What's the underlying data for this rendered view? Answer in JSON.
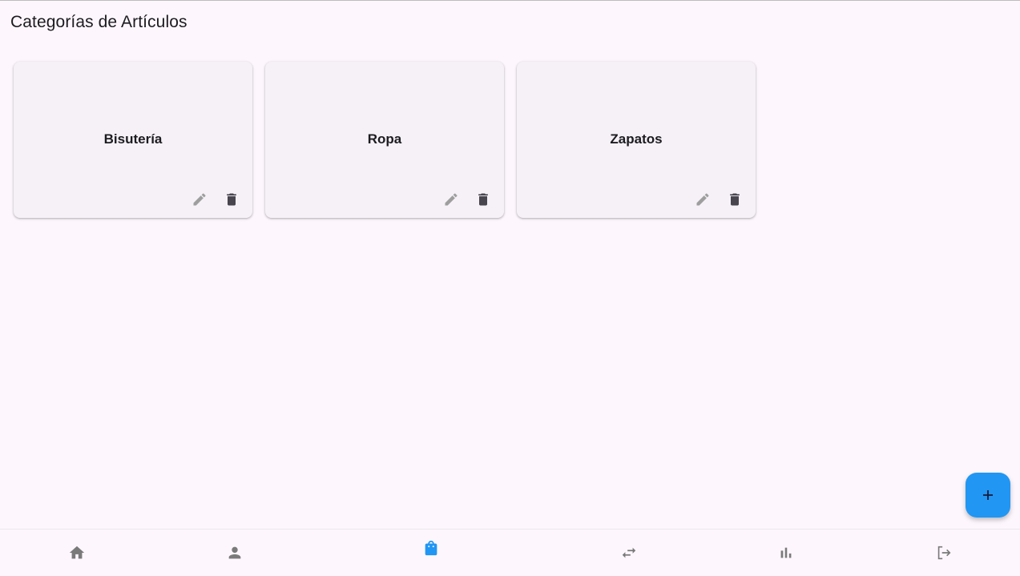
{
  "page": {
    "title": "Categorías de Artículos"
  },
  "categories": [
    {
      "name": "Bisutería"
    },
    {
      "name": "Ropa"
    },
    {
      "name": "Zapatos"
    }
  ],
  "actions": {
    "edit_icon": "edit-icon",
    "delete_icon": "delete-icon"
  },
  "fab": {
    "icon": "plus-icon",
    "color": "#2196f3"
  },
  "bottom_nav": {
    "items": [
      {
        "icon": "home-icon",
        "active": false
      },
      {
        "icon": "person-icon",
        "active": false
      },
      {
        "icon": "shopping-bag-icon",
        "active": true
      },
      {
        "icon": "swap-icon",
        "active": false
      },
      {
        "icon": "bar-chart-icon",
        "active": false
      },
      {
        "icon": "logout-icon",
        "active": false
      }
    ],
    "active_color": "#2196f3",
    "inactive_color": "#7a7a7a"
  }
}
